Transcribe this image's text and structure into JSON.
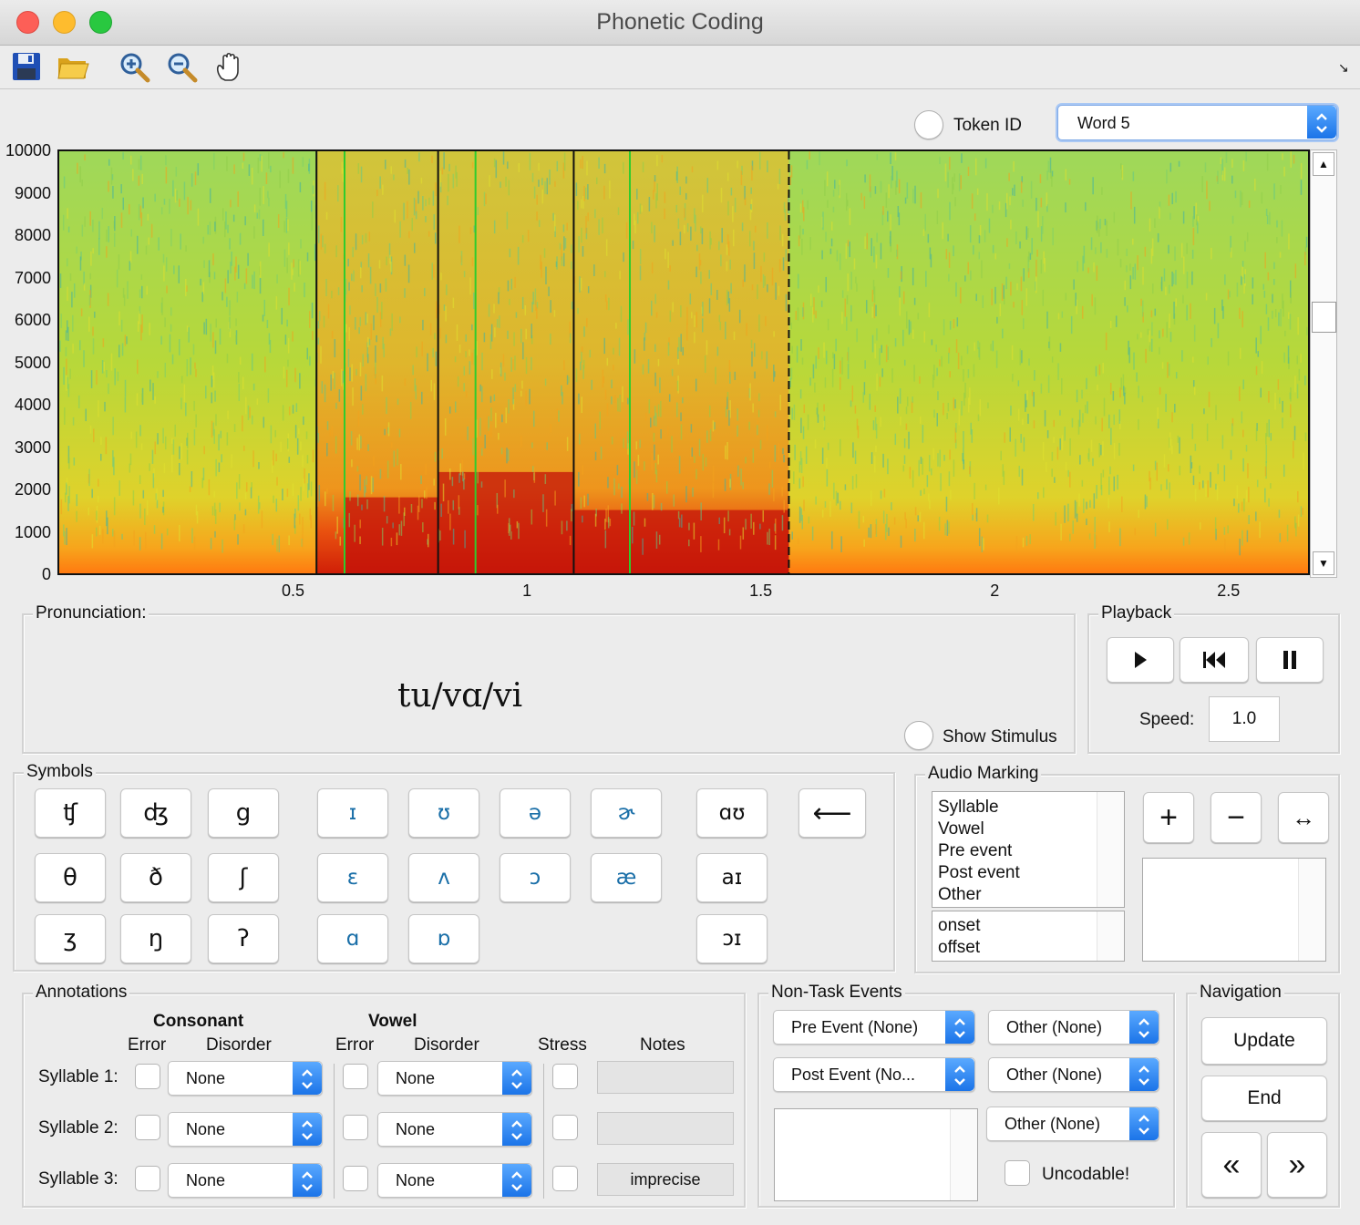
{
  "window": {
    "title": "Phonetic Coding"
  },
  "token_id": {
    "label": "Token ID",
    "word_select": "Word 5"
  },
  "toolbar": {
    "icons": [
      "save-icon",
      "open-folder-icon",
      "zoom-in-icon",
      "zoom-out-icon",
      "pan-hand-icon"
    ]
  },
  "spectrogram": {
    "y_ticks": [
      "10000",
      "9000",
      "8000",
      "7000",
      "6000",
      "5000",
      "4000",
      "3000",
      "2000",
      "1000",
      "0"
    ],
    "x_ticks": [
      "0.5",
      "1",
      "1.5",
      "2",
      "2.5"
    ],
    "x_tick_values": [
      0.5,
      1,
      1.5,
      2,
      2.5
    ],
    "x_max": 2.67,
    "y_max": 10000,
    "black_markers": [
      0.55,
      0.81,
      1.1
    ],
    "green_markers": [
      0.61,
      0.89,
      1.22
    ],
    "dashed_marker": 1.56
  },
  "pronunciation": {
    "title": "Pronunciation:",
    "text": "tu/vɑ/vi",
    "show_stimulus_label": "Show Stimulus"
  },
  "playback": {
    "title": "Playback",
    "speed_label": "Speed:",
    "speed_value": "1.0"
  },
  "symbols": {
    "title": "Symbols",
    "col1": [
      "ʧ",
      "θ",
      "ʒ"
    ],
    "col2": [
      "ʤ",
      "ð",
      "ŋ"
    ],
    "col3": [
      "g",
      "ʃ",
      "ʔ"
    ],
    "col4": [
      "ɪ",
      "ɛ",
      "ɑ"
    ],
    "col5": [
      "ʊ",
      "ʌ",
      "ɒ"
    ],
    "col6": [
      "ə",
      "ɔ"
    ],
    "col7": [
      "ɚ",
      "æ"
    ],
    "col8": [
      "ɑʊ",
      "aɪ",
      "ɔɪ"
    ],
    "backspace": "⟵"
  },
  "audio_marking": {
    "title": "Audio Marking",
    "event_types": [
      "Syllable",
      "Vowel",
      "Pre event",
      "Post event",
      "Other"
    ],
    "boundaries": [
      "onset",
      "offset"
    ],
    "add": "+",
    "remove": "−",
    "expand": "↔"
  },
  "annotations": {
    "title": "Annotations",
    "consonant_header": "Consonant",
    "vowel_header": "Vowel",
    "error_header": "Error",
    "disorder_header": "Disorder",
    "stress_header": "Stress",
    "notes_header": "Notes",
    "rows": [
      {
        "label": "Syllable 1:",
        "consonant_disorder": "None",
        "vowel_disorder": "None",
        "note": ""
      },
      {
        "label": "Syllable 2:",
        "consonant_disorder": "None",
        "vowel_disorder": "None",
        "note": ""
      },
      {
        "label": "Syllable 3:",
        "consonant_disorder": "None",
        "vowel_disorder": "None",
        "note": "imprecise"
      }
    ]
  },
  "non_task_events": {
    "title": "Non-Task Events",
    "pre_event": "Pre Event (None)",
    "post_event": "Post Event (No...",
    "other_1": "Other (None)",
    "other_2": "Other (None)",
    "other_3": "Other (None)",
    "uncodable": "Uncodable!"
  },
  "navigation": {
    "title": "Navigation",
    "update": "Update",
    "end": "End",
    "prev": "«",
    "next": "»"
  }
}
